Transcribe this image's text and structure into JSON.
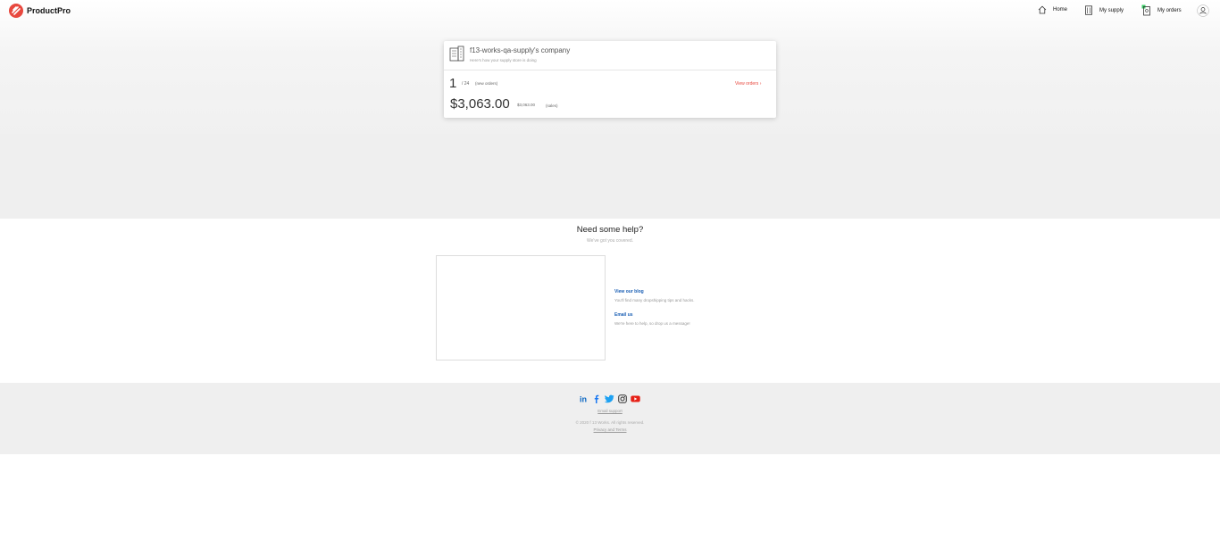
{
  "app": {
    "name": "ProductPro"
  },
  "nav": {
    "home": "Home",
    "supply": "My supply",
    "orders": "My orders"
  },
  "card": {
    "company": "f13-works-qa-supply's company",
    "subtitle": "Here's how your supply store is doing",
    "orders_count": "1",
    "orders_total": "/ 24",
    "orders_label": "(new orders)",
    "view_orders": "View orders",
    "sales": "$3,063.00",
    "sales_small": "$3,063.00",
    "sales_label": "(sales)"
  },
  "help": {
    "title": "Need some help?",
    "subtitle": "We've got you covered.",
    "blog_link": "View our blog",
    "blog_desc": "You'll find many dropshipping tips and hacks.",
    "email_link": "Email us",
    "email_desc": "We're here to help, so drop us a message!"
  },
  "footer": {
    "social": [
      "linkedin-icon",
      "facebook-icon",
      "twitter-icon",
      "instagram-icon",
      "youtube-icon"
    ],
    "email_support": "Email support",
    "copyright": "© 2020 f 13 Works. All rights reserved.",
    "privacy": "Privacy and Terms"
  },
  "colors": {
    "brand": "#e8483e",
    "link": "#1a5fb4",
    "hero_bg": "#efefef",
    "footer_bg": "#efefef"
  }
}
